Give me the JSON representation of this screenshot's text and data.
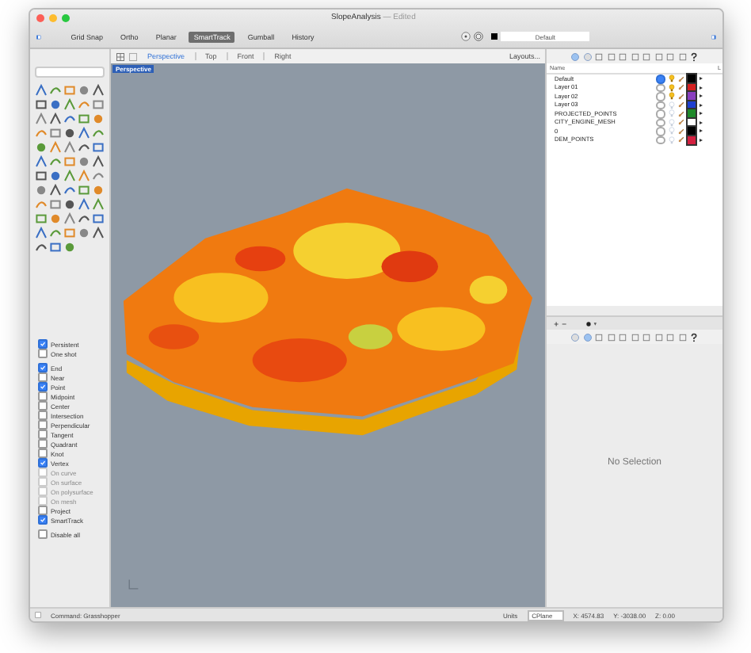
{
  "window": {
    "title": "SlopeAnalysis",
    "title_suffix": "— Edited"
  },
  "toolbar": {
    "toggles": [
      {
        "label": "Grid Snap",
        "selected": false
      },
      {
        "label": "Ortho",
        "selected": false
      },
      {
        "label": "Planar",
        "selected": false
      },
      {
        "label": "SmartTrack",
        "selected": true
      },
      {
        "label": "Gumball",
        "selected": false
      },
      {
        "label": "History",
        "selected": false
      }
    ],
    "layer_field": "Default"
  },
  "viewport_tabs": [
    {
      "label": "Perspective",
      "selected": true
    },
    {
      "label": "Top",
      "selected": false
    },
    {
      "label": "Front",
      "selected": false
    },
    {
      "label": "Right",
      "selected": false
    }
  ],
  "layouts_button": "Layouts...",
  "viewport": {
    "label": "Perspective"
  },
  "osnap_groups": [
    {
      "items": [
        {
          "label": "Persistent",
          "checked": true,
          "disabled": false
        },
        {
          "label": "One shot",
          "checked": false,
          "disabled": false
        }
      ]
    },
    {
      "items": [
        {
          "label": "End",
          "checked": true,
          "disabled": false
        },
        {
          "label": "Near",
          "checked": false,
          "disabled": false
        },
        {
          "label": "Point",
          "checked": true,
          "disabled": false
        },
        {
          "label": "Midpoint",
          "checked": false,
          "disabled": false
        },
        {
          "label": "Center",
          "checked": false,
          "disabled": false
        },
        {
          "label": "Intersection",
          "checked": false,
          "disabled": false
        },
        {
          "label": "Perpendicular",
          "checked": false,
          "disabled": false
        },
        {
          "label": "Tangent",
          "checked": false,
          "disabled": false
        },
        {
          "label": "Quadrant",
          "checked": false,
          "disabled": false
        },
        {
          "label": "Knot",
          "checked": false,
          "disabled": false
        },
        {
          "label": "Vertex",
          "checked": true,
          "disabled": false
        },
        {
          "label": "On curve",
          "checked": false,
          "disabled": true
        },
        {
          "label": "On surface",
          "checked": false,
          "disabled": true
        },
        {
          "label": "On polysurface",
          "checked": false,
          "disabled": true
        },
        {
          "label": "On mesh",
          "checked": false,
          "disabled": true
        },
        {
          "label": "Project",
          "checked": false,
          "disabled": false
        },
        {
          "label": "SmartTrack",
          "checked": true,
          "disabled": false
        }
      ]
    },
    {
      "items": [
        {
          "label": "Disable all",
          "checked": false,
          "disabled": false
        }
      ]
    }
  ],
  "layers": {
    "columns": [
      "Name",
      "L"
    ],
    "rows": [
      {
        "name": "Default",
        "current": true,
        "light_on": true,
        "color": "#000000"
      },
      {
        "name": "Layer 01",
        "current": false,
        "light_on": true,
        "color": "#d42020"
      },
      {
        "name": "Layer 02",
        "current": false,
        "light_on": true,
        "color": "#8a3fbf"
      },
      {
        "name": "Layer 03",
        "current": false,
        "light_on": false,
        "color": "#1f3fd0"
      },
      {
        "name": "PROJECTED_POINTS",
        "current": false,
        "light_on": false,
        "color": "#1f8a2a"
      },
      {
        "name": "CITY_ENGINE_MESH",
        "current": false,
        "light_on": false,
        "color": "#ffffff"
      },
      {
        "name": "0",
        "current": false,
        "light_on": false,
        "color": "#000000"
      },
      {
        "name": "DEM_POINTS",
        "current": false,
        "light_on": false,
        "color": "#d42040"
      }
    ]
  },
  "properties_panel": {
    "message": "No Selection"
  },
  "status_bar": {
    "command": "Command: Grasshopper",
    "units_label": "Units",
    "cplane": "CPlane",
    "x": "X: 4574.83",
    "y": "Y: -3038.00",
    "z": "Z: 0.00"
  }
}
